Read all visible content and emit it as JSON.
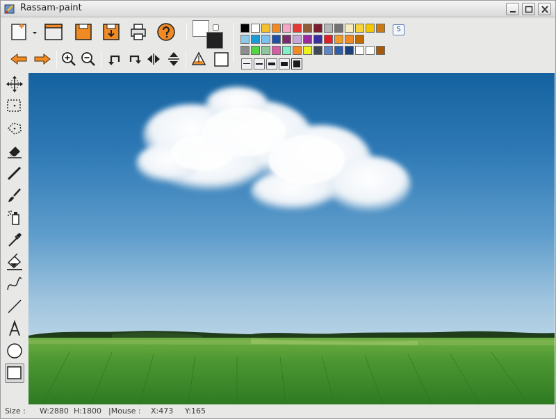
{
  "window": {
    "title": "Rassam-paint"
  },
  "colors": {
    "accent_orange": "#f08a24",
    "window_bg": "#e8e8e7",
    "sky_top": "#14629f",
    "grass": "#3f8e2c"
  },
  "toolbar": {
    "buttons": [
      {
        "name": "new-file-icon"
      },
      {
        "name": "new-dropdown-icon"
      },
      {
        "name": "open-file-icon"
      },
      {
        "name": "save-icon"
      },
      {
        "name": "save-as-icon"
      },
      {
        "name": "print-icon"
      },
      {
        "name": "help-icon"
      },
      {
        "name": "undo-arrow-icon"
      },
      {
        "name": "redo-arrow-icon"
      },
      {
        "name": "zoom-in-icon"
      },
      {
        "name": "zoom-out-icon"
      },
      {
        "name": "rotate-left-icon"
      },
      {
        "name": "rotate-right-icon"
      },
      {
        "name": "flip-horizontal-icon"
      },
      {
        "name": "flip-vertical-icon"
      },
      {
        "name": "fill-shape-icon"
      },
      {
        "name": "outline-shape-icon"
      }
    ],
    "s_button_label": "S"
  },
  "palette": {
    "rows": [
      [
        "#000000",
        "#ffffff",
        "#f2c12e",
        "#f08a24",
        "#f7a7c4",
        "#e53935",
        "#8e5d38",
        "#7b1e2e",
        "#b5b5b5",
        "#737373",
        "#f4edc0",
        "#f5d538",
        "#f3c700",
        "#c97a12"
      ],
      [
        "#8cc8e8",
        "#1a9ad6",
        "#7fc1ee",
        "#1f4fa6",
        "#7a2a6e",
        "#c6a7d8",
        "#9a2aa0",
        "#3a2ea0",
        "#e11d2a",
        "#f09a28",
        "#f08a24",
        "#c06a00"
      ],
      [
        "#8d8d8d",
        "#56d448",
        "#8ec79b",
        "#d45ea3",
        "#7ff0c8",
        "#f08a24",
        "#e9f21f",
        "#3e4a55",
        "#5f87c8",
        "#2f5ea8",
        "#1a3f7a",
        "#ffffff",
        "#ffffff",
        "#a45a08"
      ]
    ]
  },
  "line_widths": [
    "thin",
    "medium",
    "thick",
    "thicker",
    "thickest"
  ],
  "tools": [
    "move-icon",
    "rect-select-icon",
    "lasso-select-icon",
    "eraser-icon",
    "pencil-icon",
    "brush-icon",
    "spray-icon",
    "color-picker-icon",
    "fill-bucket-icon",
    "curve-icon",
    "line-icon",
    "text-icon",
    "ellipse-icon",
    "rectangle-icon"
  ],
  "status": {
    "size_label": "Size :",
    "w": "W:2880",
    "h": "H:1800",
    "mouse_label": "|Mouse :",
    "x": "X:473",
    "y": "Y:165"
  }
}
